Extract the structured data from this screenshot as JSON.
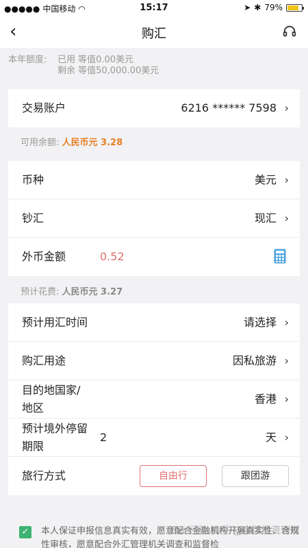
{
  "status_bar": {
    "carrier": "中国移动",
    "time": "15:17",
    "battery": "79%",
    "battery_level": 0.79
  },
  "nav": {
    "title": "购汇"
  },
  "quota": {
    "label": "本年额度:",
    "used": "已用  等值0.00美元",
    "remaining": "剩余  等值50,000.00美元"
  },
  "account": {
    "label": "交易账户",
    "number": "6216 ****** 7598"
  },
  "balance": {
    "label": "可用余额:",
    "value": "人民币元  3.28"
  },
  "currency": {
    "label": "币种",
    "value": "美元"
  },
  "cash_type": {
    "label": "钞汇",
    "value": "现汇"
  },
  "amount": {
    "label": "外币金额",
    "value": "0.52"
  },
  "estimated_cost": {
    "label": "预计花费:",
    "value": "人民币元  3.27"
  },
  "use_time": {
    "label": "预计用汇时间",
    "value": "请选择"
  },
  "purpose": {
    "label": "购汇用途",
    "value": "因私旅游"
  },
  "destination": {
    "label_line1": "目的地国家/",
    "label_line2": "地区",
    "value": "香港"
  },
  "stay": {
    "label_line1": "预计境外停留",
    "label_line2": "期限",
    "number": "2",
    "unit": "天"
  },
  "travel_mode": {
    "label": "旅行方式",
    "options": [
      "自由行",
      "跟团游"
    ],
    "selected": "自由行"
  },
  "agreement": {
    "text": "本人保证申报信息真实有效，愿意配合金融机构开展真实性、合规性审核，愿意配合外汇管理机关调查和监督检"
  },
  "watermark": "Bai 经验  知乎 @金牌投资理财"
}
